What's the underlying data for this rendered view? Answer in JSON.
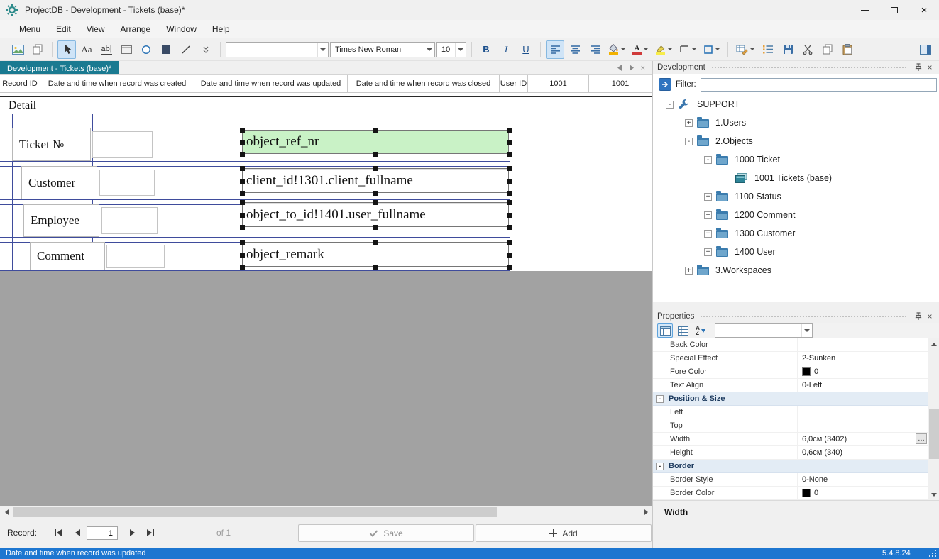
{
  "titlebar": {
    "title": "ProjectDB - Development - Tickets (base)*"
  },
  "menubar": {
    "items": [
      "Menu",
      "Edit",
      "View",
      "Arrange",
      "Window",
      "Help"
    ]
  },
  "toolbar": {
    "label_tool": "Aa",
    "textbox_tool": "ab|",
    "style_combo_value": "",
    "font_name": "Times New Roman",
    "font_size": "10",
    "bold": "B",
    "italic": "I",
    "underline": "U"
  },
  "tabbar": {
    "active_tab": "Development - Tickets (base)*"
  },
  "designer": {
    "columns_header": [
      "Record ID",
      "Date and time when record was created",
      "Date and time when record was updated",
      "Date and time when record was closed",
      "User ID",
      "1001",
      "1001"
    ],
    "band_label": "Detail",
    "labels": [
      "Ticket №",
      "Customer",
      "Employee",
      "Comment"
    ],
    "fields": [
      "object_ref_nr",
      "client_id!1301.client_fullname",
      "object_to_id!1401.user_fullname",
      "object_remark"
    ]
  },
  "recordbar": {
    "label": "Record:",
    "current": "1",
    "count_text": "of  1",
    "save_label": "Save",
    "add_label": "Add"
  },
  "dev_panel": {
    "title": "Development",
    "filter_label": "Filter:",
    "filter_value": "",
    "tree": [
      {
        "label": "SUPPORT",
        "level": 0,
        "expander": "-",
        "icon": "wrench"
      },
      {
        "label": "1.Users",
        "level": 1,
        "expander": "+",
        "icon": "folder"
      },
      {
        "label": "2.Objects",
        "level": 1,
        "expander": "-",
        "icon": "folder"
      },
      {
        "label": "1000 Ticket",
        "level": 2,
        "expander": "-",
        "icon": "folder"
      },
      {
        "label": "1001 Tickets (base)",
        "level": 3,
        "expander": "",
        "icon": "form"
      },
      {
        "label": "1100 Status",
        "level": 2,
        "expander": "+",
        "icon": "folder"
      },
      {
        "label": "1200 Comment",
        "level": 2,
        "expander": "+",
        "icon": "folder"
      },
      {
        "label": "1300 Customer",
        "level": 2,
        "expander": "+",
        "icon": "folder"
      },
      {
        "label": "1400 User",
        "level": 2,
        "expander": "+",
        "icon": "folder"
      },
      {
        "label": "3.Workspaces",
        "level": 1,
        "expander": "+",
        "icon": "folder"
      }
    ]
  },
  "properties_panel": {
    "title": "Properties",
    "combo_value": "",
    "rows": [
      {
        "type": "prop",
        "name": "Back Color",
        "value": ""
      },
      {
        "type": "prop",
        "name": "Special Effect",
        "value": "2-Sunken"
      },
      {
        "type": "prop",
        "name": "Fore Color",
        "value": "0",
        "swatch": "#000000"
      },
      {
        "type": "prop",
        "name": "Text Align",
        "value": "0-Left"
      },
      {
        "type": "category",
        "name": "Position & Size",
        "expander": "-"
      },
      {
        "type": "prop",
        "name": "Left",
        "value": ""
      },
      {
        "type": "prop",
        "name": "Top",
        "value": ""
      },
      {
        "type": "prop",
        "name": "Width",
        "value": "6,0см (3402)",
        "browse": true
      },
      {
        "type": "prop",
        "name": "Height",
        "value": "0,6см (340)"
      },
      {
        "type": "category",
        "name": "Border",
        "expander": "-"
      },
      {
        "type": "prop",
        "name": "Border Style",
        "value": "0-None"
      },
      {
        "type": "prop",
        "name": "Border Color",
        "value": "0",
        "swatch": "#000000"
      }
    ],
    "footer": "Width"
  },
  "statusbar": {
    "left": "Date and time when record was updated",
    "version": "5.4.8.24"
  },
  "icons": {
    "close": "×",
    "font_color_letter": "A",
    "sort_a": "A",
    "sort_z": "Z",
    "ellipsis": "…"
  },
  "colors": {
    "tab_active": "#1a7a91",
    "status_bar": "#1d76d0",
    "field_selected": "#c9f2c6",
    "accent_blue": "#2f74c0"
  }
}
